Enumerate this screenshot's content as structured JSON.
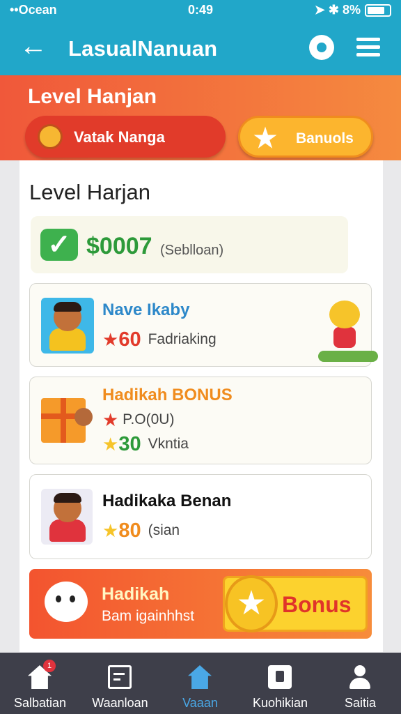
{
  "status": {
    "carrier": "••Ocean",
    "time": "0:49",
    "battery": "8%"
  },
  "appbar": {
    "title": "LasualNanuan",
    "back_icon": "arrow-left-icon",
    "location_icon": "location-pin-icon",
    "menu_icon": "menu-icon"
  },
  "hero": {
    "title": "Level Hanjan",
    "tab1_label": "Vatak Nanga",
    "tab2_label": "Banuols"
  },
  "panel": {
    "title": "Level Harjan"
  },
  "balance": {
    "amount": "$0007",
    "note": "(Seblloan)"
  },
  "cards": [
    {
      "title": "Nave Ikaby",
      "value": "60",
      "caption": "Fadriaking"
    },
    {
      "title": "Hadikah BONUS",
      "line1": "P.O(0U)",
      "value": "30",
      "caption": "Vkntia"
    },
    {
      "title": "Hadikaka Benan",
      "value": "80",
      "caption": "(sian"
    }
  ],
  "banner": {
    "title": "Hadikah",
    "subtitle": "Bam igainhhst",
    "button_label": "Bonus"
  },
  "nav": [
    {
      "label": "Salbatian",
      "badge": "1"
    },
    {
      "label": "Waanloan"
    },
    {
      "label": "Vaaan"
    },
    {
      "label": "Kuohikian"
    },
    {
      "label": "Saitia"
    }
  ],
  "colors": {
    "header": "#21a7c9",
    "hero": "#f0583a",
    "accent_blue": "#4aa8e6",
    "green": "#2d9a3a"
  }
}
